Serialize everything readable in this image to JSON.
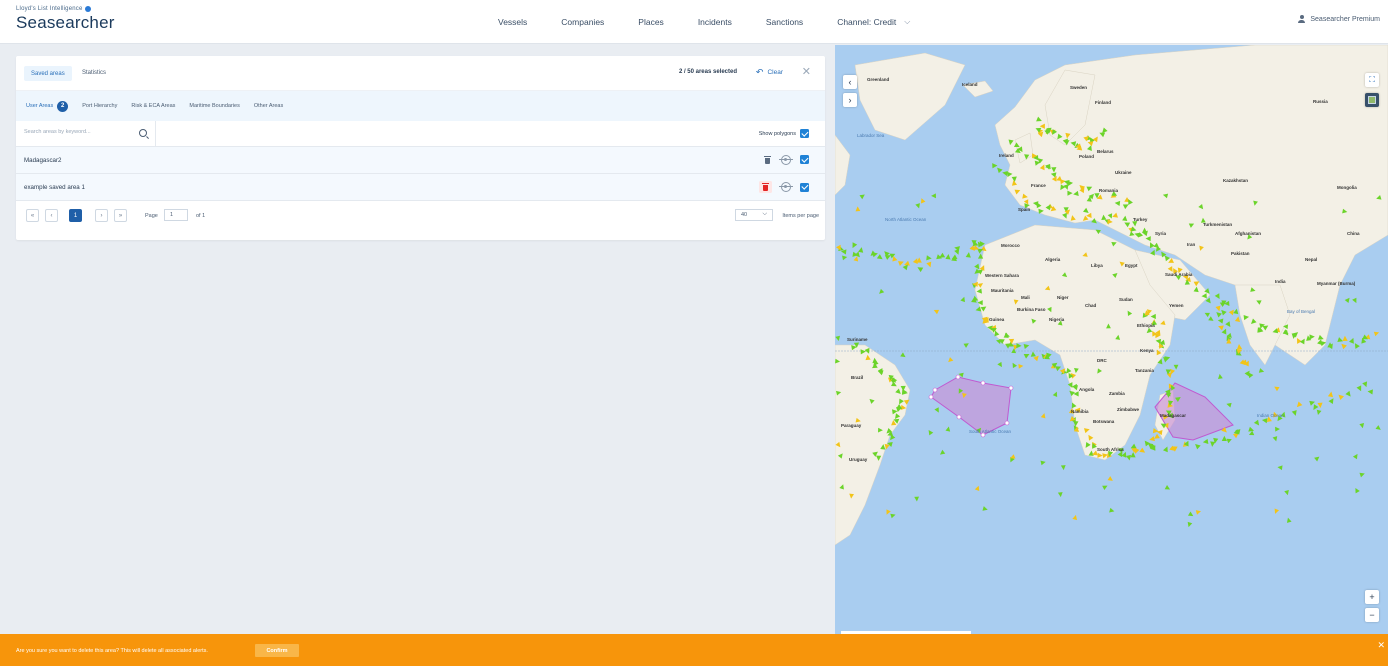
{
  "header": {
    "brand_tagline": "Lloyd's List Intelligence",
    "brand_name": "Seasearcher",
    "nav": [
      "Vessels",
      "Companies",
      "Places",
      "Incidents",
      "Sanctions",
      "Channel: Credit"
    ],
    "nav_chevron_icon": "chevron-down-icon",
    "user_label": "Seasearcher Premium",
    "user_icon": "user-icon"
  },
  "panel": {
    "tab_saved_areas": "Saved areas",
    "tab_statistics": "Statistics",
    "selected_count": "2 / 50 areas selected",
    "clear_label": "Clear",
    "clear_icon": "undo-icon",
    "close_icon": "close-icon",
    "subtabs": [
      "User Areas",
      "Port Hierarchy",
      "Risk & ECA Areas",
      "Maritime Boundaries",
      "Other Areas"
    ],
    "user_areas_count": "2",
    "search_placeholder": "Search areas by keyword...",
    "show_polygons_label": "Show polygons",
    "rows": [
      {
        "name": "Madagascar2"
      },
      {
        "name": "example saved area 1"
      }
    ],
    "pager": {
      "first": "«",
      "prev": "‹",
      "current_page": "1",
      "next": "›",
      "last": "»",
      "page_label": "Page",
      "page_value": "1",
      "of_label": "of 1",
      "per_page_value": "40",
      "per_page_label": "Items per page"
    }
  },
  "map": {
    "labels": {
      "greenland": "Greenland",
      "iceland": "Iceland",
      "sweden": "Sweden",
      "finland": "Finland",
      "russia": "Russia",
      "labrador_sea": "Labrador Sea",
      "ireland": "Ireland",
      "poland": "Poland",
      "belarus": "Belarus",
      "ukraine": "Ukraine",
      "france": "France",
      "romania": "Romania",
      "kazakhstan": "Kazakhstan",
      "mongolia": "Mongolia",
      "spain": "Spain",
      "turkey": "Turkey",
      "turkmenistan": "Turkmenistan",
      "syria": "Syria",
      "iran": "Iran",
      "afghanistan": "Afghanistan",
      "china": "China",
      "pakistan": "Pakistan",
      "nepal": "Nepal",
      "north_atlantic": "North Atlantic Ocean",
      "morocco": "Morocco",
      "algeria": "Algeria",
      "libya": "Libya",
      "egypt": "Egypt",
      "saudi_arabia": "Saudi Arabia",
      "india": "India",
      "myanmar": "Myanmar (Burma)",
      "western_sahara": "Western Sahara",
      "mauritania": "Mauritania",
      "mali": "Mali",
      "niger": "Niger",
      "chad": "Chad",
      "sudan": "Sudan",
      "yemen": "Yemen",
      "burkina_faso": "Burkina Faso",
      "guinea": "Guinea",
      "nigeria": "Nigeria",
      "ethiopia": "Ethiopia",
      "bay_of_bengal": "Bay of Bengal",
      "kenya": "Kenya",
      "drc": "DRC",
      "tanzania": "Tanzania",
      "angola": "Angola",
      "zambia": "Zambia",
      "namibia": "Namibia",
      "zimbabwe": "Zimbabwe",
      "botswana": "Botswana",
      "madagascar": "Madagascar",
      "south_africa": "South Africa",
      "indian_ocean": "Indian Ocean",
      "south_atlantic": "South Atlantic Ocean",
      "brazil": "Brazil",
      "paraguay": "Paraguay",
      "uruguay": "Uruguay",
      "suriname": "Suriname"
    },
    "collapse_icon": "chevron-left-icon",
    "expand_icon": "chevron-right-icon",
    "fullscreen_icon": "fullscreen-icon",
    "layer_icon": "layers-icon",
    "zoom_in": "+",
    "zoom_out": "−",
    "colors": {
      "sea": "#a9cdf0",
      "land": "#f3f0e6",
      "vessel_green": "#6bd42a",
      "vessel_yellow": "#f2c419",
      "polygon_fill": "#c98fd6",
      "polygon_stroke": "#c05ad0"
    }
  },
  "banner": {
    "message": "Are you sure you want to delete this area? This will delete all associated alerts.",
    "confirm_label": "Confirm",
    "close_icon": "close-icon"
  }
}
